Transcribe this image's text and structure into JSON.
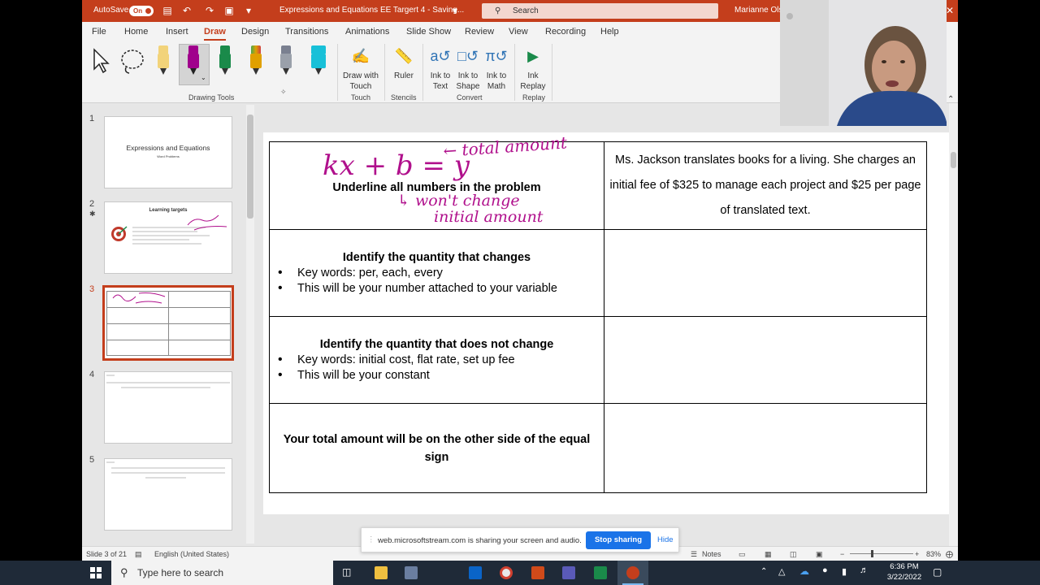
{
  "titlebar": {
    "autosave_label": "AutoSave",
    "autosave_state": "On",
    "doc_title": "Expressions and Equations EE Targert 4  -  Saving...",
    "search_placeholder": "Search",
    "user_name": "Marianne Olsen"
  },
  "menu": {
    "items": [
      "File",
      "Home",
      "Insert",
      "Draw",
      "Design",
      "Transitions",
      "Animations",
      "Slide Show",
      "Review",
      "View",
      "Recording",
      "Help"
    ],
    "active": "Draw"
  },
  "ribbon": {
    "groups": {
      "drawing_tools": "Drawing Tools",
      "touch": "Touch",
      "stencils": "Stencils",
      "convert": "Convert",
      "replay": "Replay"
    },
    "buttons": {
      "draw_with_touch": [
        "Draw with",
        "Touch"
      ],
      "ruler": [
        "Ruler"
      ],
      "ink_to_text": [
        "Ink to",
        "Text"
      ],
      "ink_to_shape": [
        "Ink to",
        "Shape"
      ],
      "ink_to_math": [
        "Ink to",
        "Math"
      ],
      "ink_replay": [
        "Ink",
        "Replay"
      ]
    },
    "pens": [
      {
        "name": "select-tool"
      },
      {
        "name": "lasso-tool"
      },
      {
        "color": "#f2d37a",
        "cap": "#f2d37a"
      },
      {
        "color": "#a0008c",
        "cap": "#a0008c"
      },
      {
        "color": "#1a8a4a",
        "cap": "#1a8a4a"
      },
      {
        "color": "#e0a000",
        "cap": "#4aa84a"
      },
      {
        "color": "#9aa0aa",
        "cap": "#7a8090"
      },
      {
        "color": "#18c0d8",
        "cap": "#18c0d8"
      }
    ]
  },
  "thumbnails": [
    {
      "num": "1",
      "title": "Expressions and Equations",
      "subtitle": "Word Problems"
    },
    {
      "num": "2",
      "title": "Learning targets",
      "starred": true
    },
    {
      "num": "3",
      "selected": true
    },
    {
      "num": "4"
    },
    {
      "num": "5"
    }
  ],
  "slide": {
    "rows": [
      {
        "left_heading": "Underline all numbers in the problem",
        "left_bullets": [],
        "right": "Ms. Jackson translates books for a living. She charges an initial fee of $325 to manage each project and $25 per page of translated text."
      },
      {
        "left_heading": "Identify the quantity that changes",
        "left_bullets": [
          "Key words: per, each, every",
          "This will be your number attached to your variable"
        ],
        "right": ""
      },
      {
        "left_heading": "Identify the quantity that does not change",
        "left_bullets": [
          "Key words: initial cost, flat rate, set up fee",
          "This will be your constant"
        ],
        "right": ""
      },
      {
        "left_heading": "Your total amount will be on the other side of the equal sign",
        "left_bullets": [],
        "right": ""
      }
    ],
    "ink": {
      "color": "#b0108c",
      "equation": "kx + b = y",
      "note_total": "← total amount",
      "note_wont": "↳ won't change",
      "note_initial": "initial amount"
    }
  },
  "statusbar": {
    "slide_info": "Slide 3 of 21",
    "language": "English (United States)",
    "notes_label": "Notes",
    "zoom": "83%"
  },
  "sharebar": {
    "message": "web.microsoftstream.com is sharing your screen and audio.",
    "stop_label": "Stop sharing",
    "hide_label": "Hide"
  },
  "taskbar": {
    "search_placeholder": "Type here to search",
    "time": "6:36 PM",
    "date": "3/22/2022"
  }
}
